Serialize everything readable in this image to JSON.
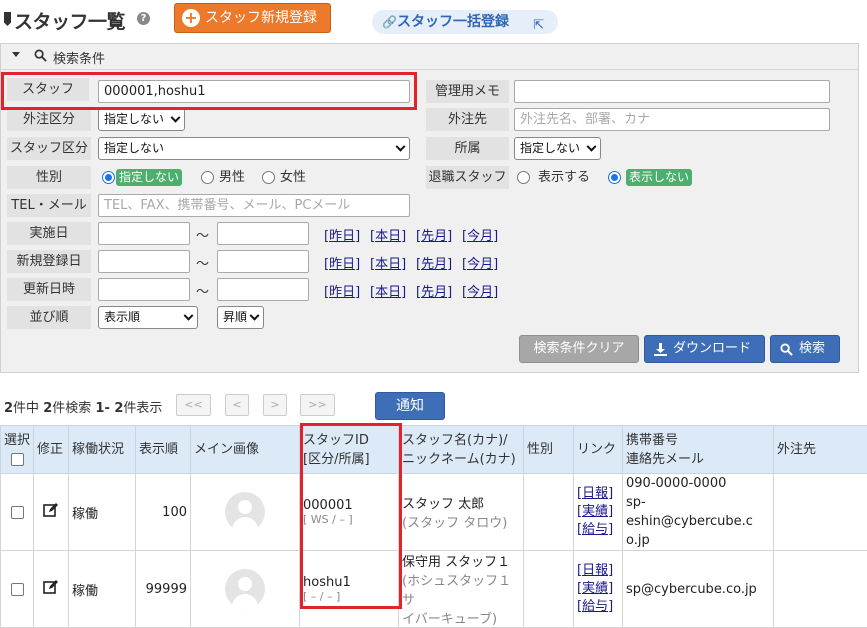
{
  "header": {
    "title": "スタッフ一覧",
    "help_icon": "?",
    "new_button": "スタッフ新規登録",
    "bulk_button": "スタッフ一括登録"
  },
  "search": {
    "panel_title": "検索条件",
    "staff_label": "スタッフ",
    "staff_value": "000001,hoshu1",
    "memo_label": "管理用メモ",
    "memo_value": "",
    "outsource_type_label": "外注区分",
    "outsource_type_value": "指定しない",
    "outsource_label": "外注先",
    "outsource_placeholder": "外注先名、部署、カナ",
    "staff_type_label": "スタッフ区分",
    "staff_type_value": "指定しない",
    "affiliation_label": "所属",
    "affiliation_value": "指定しない",
    "gender_label": "性別",
    "gender_opt_none": "指定しない",
    "gender_opt_male": "男性",
    "gender_opt_female": "女性",
    "retired_label": "退職スタッフ",
    "retired_opt_show": "表示する",
    "retired_opt_hide": "表示しない",
    "contact_label": "TEL・メール",
    "contact_placeholder": "TEL、FAX、携帯番号、メール、PCメール",
    "date_rows": [
      {
        "label": "実施日"
      },
      {
        "label": "新規登録日"
      },
      {
        "label": "更新日時"
      }
    ],
    "range_sep": "〜",
    "quick_links": [
      "昨日",
      "本日",
      "先月",
      "今月"
    ],
    "sort_label": "並び順",
    "sort_value": "表示順",
    "order_value": "昇順",
    "clear_button": "検索条件クリア",
    "download_button": "ダウンロード",
    "search_button": "検索"
  },
  "results": {
    "summary_count": "2",
    "summary_mid": "件中",
    "summary_hit": "2",
    "summary_hit_txt": "件検索",
    "summary_range": "1- 2",
    "summary_show": "件表示",
    "pager": [
      "<<",
      "<",
      ">",
      ">>"
    ],
    "notify_button": "通知"
  },
  "table": {
    "headers": {
      "select": "選択",
      "edit": "修正",
      "status": "稼働状況",
      "order": "表示順",
      "image": "メイン画像",
      "id1": "スタッフID",
      "id2": "[区分/所属]",
      "name1": "スタッフ名(カナ)/",
      "name2": "ニックネーム(カナ)",
      "gender": "性別",
      "link": "リンク",
      "contact1": "携帯番号",
      "contact2": "連絡先メール",
      "outsource": "外注先"
    },
    "rows": [
      {
        "status": "稼働",
        "order": "100",
        "staff_id": "000001",
        "sub": "[ WS / – ]",
        "name": "スタッフ 太郎",
        "kana": "(スタッフ タロウ)",
        "links": [
          "[日報]",
          "[実績]",
          "[給与]"
        ],
        "mobile": "090-0000-0000",
        "email": "sp-eshin@cybercube.c",
        "email2": "o.jp"
      },
      {
        "status": "稼働",
        "order": "99999",
        "staff_id": "hoshu1",
        "sub": "[ – / – ]",
        "name": "保守用 スタッフ１",
        "kana": "(ホシュスタッフ１ サ",
        "kana2": "イバーキューブ)",
        "links": [
          "[日報]",
          "[実績]",
          "[給与]"
        ],
        "mobile": "",
        "email": "sp@cybercube.co.jp",
        "email2": ""
      }
    ]
  }
}
